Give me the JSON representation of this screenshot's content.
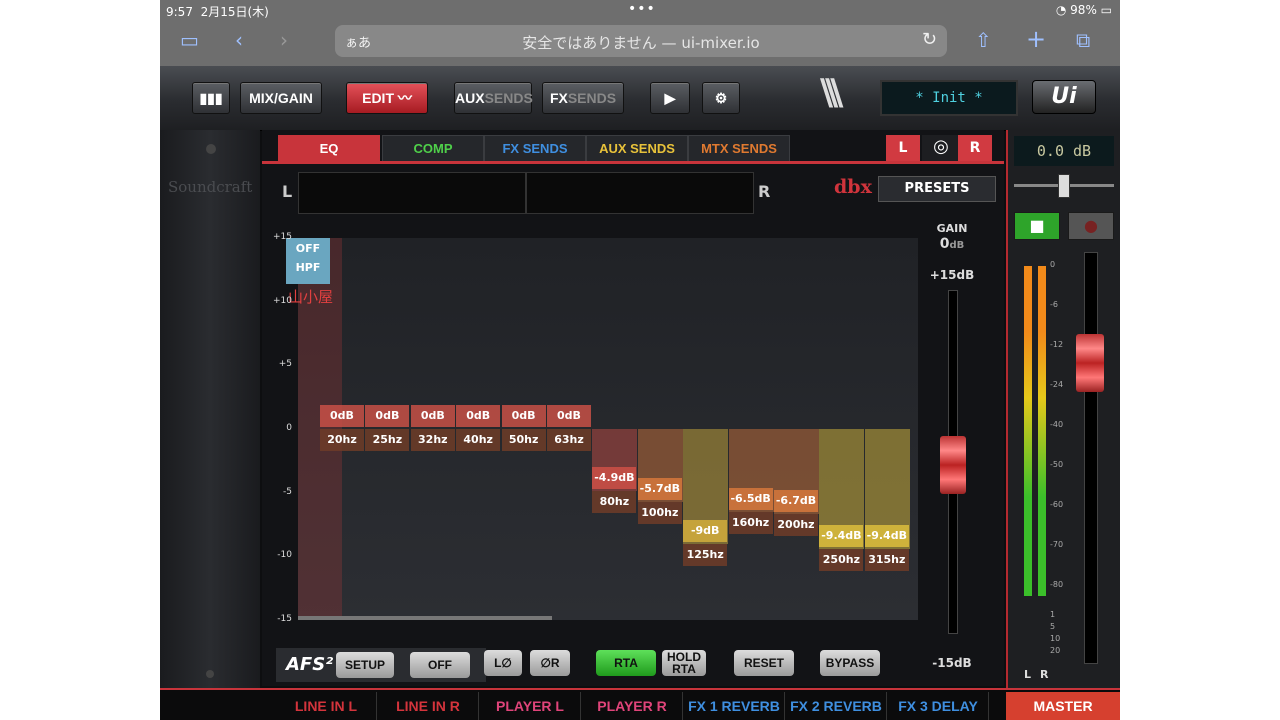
{
  "status": {
    "time": "9:57",
    "date": "2月15日(木)",
    "dots": "•••",
    "battery": "98%"
  },
  "safari": {
    "aa": "ぁあ",
    "url": "安全ではありません — ui-mixer.io",
    "reload": "↻"
  },
  "toolbar": {
    "mixgain": "MIX/GAIN",
    "edit": "EDIT",
    "aux_a": "AUX",
    "aux_b": "SENDS",
    "fx_a": "FX",
    "fx_b": "SENDS",
    "scene": "* Init *",
    "logo": "Ui"
  },
  "brand": "Soundcraft",
  "tabs": [
    "EQ",
    "COMP",
    "FX SENDS",
    "AUX SENDS",
    "MTX SENDS"
  ],
  "tab_colors": [
    "#ffffff",
    "#4fd04a",
    "#3f8fe0",
    "#e8c23a",
    "#e07a30"
  ],
  "lr": {
    "left": "L",
    "right": "R",
    "link": "◎"
  },
  "meter_labels": {
    "left": "L",
    "right": "R"
  },
  "dbx": "dbx",
  "presets": "PRESETS",
  "hpf": {
    "state": "OFF",
    "label": "HPF"
  },
  "annotation": "山小屋",
  "y_labels": [
    "+15",
    "+10",
    "+5",
    "0",
    "-5",
    "-10",
    "-15"
  ],
  "bands": [
    {
      "gain": "0dB",
      "freq": "20hz",
      "db": 0
    },
    {
      "gain": "0dB",
      "freq": "25hz",
      "db": 0
    },
    {
      "gain": "0dB",
      "freq": "32hz",
      "db": 0
    },
    {
      "gain": "0dB",
      "freq": "40hz",
      "db": 0
    },
    {
      "gain": "0dB",
      "freq": "50hz",
      "db": 0
    },
    {
      "gain": "0dB",
      "freq": "63hz",
      "db": 0
    },
    {
      "gain": "-4.9dB",
      "freq": "80hz",
      "db": -4.9
    },
    {
      "gain": "-5.7dB",
      "freq": "100hz",
      "db": -5.7
    },
    {
      "gain": "-9dB",
      "freq": "125hz",
      "db": -9
    },
    {
      "gain": "-6.5dB",
      "freq": "160hz",
      "db": -6.5
    },
    {
      "gain": "-6.7dB",
      "freq": "200hz",
      "db": -6.7
    },
    {
      "gain": "-9.4dB",
      "freq": "250hz",
      "db": -9.4
    },
    {
      "gain": "-9.4dB",
      "freq": "315hz",
      "db": -9.4
    }
  ],
  "gain": {
    "title": "GAIN",
    "value": "0",
    "unit": "dB",
    "max": "+15dB",
    "min": "-15dB"
  },
  "controls": {
    "afs": "AFS²",
    "setup": "SETUP",
    "afs_state": "OFF",
    "l_phase": "L∅",
    "r_phase": "∅R",
    "rta": "RTA",
    "hold1": "HOLD",
    "hold2": "RTA",
    "reset": "RESET",
    "bypass": "BYPASS"
  },
  "master": {
    "db": "0.0 dB",
    "ticks": [
      "0",
      "-6",
      "-12",
      "-24",
      "-40",
      "-50",
      "-60",
      "-70",
      "-80"
    ],
    "ticks2": [
      "1",
      "5",
      "10",
      "20"
    ],
    "l": "L",
    "r": "R"
  },
  "channels": [
    {
      "name": "LINE IN L",
      "color": "#d4343c"
    },
    {
      "name": "LINE IN R",
      "color": "#d4343c"
    },
    {
      "name": "PLAYER L",
      "color": "#e0447a"
    },
    {
      "name": "PLAYER R",
      "color": "#e0447a"
    },
    {
      "name": "FX 1 REVERB",
      "color": "#3f8fe0"
    },
    {
      "name": "FX 2 REVERB",
      "color": "#3f8fe0"
    },
    {
      "name": "FX 3 DELAY",
      "color": "#3f8fe0"
    },
    {
      "name": "MASTER",
      "color": "#ffffff"
    }
  ]
}
